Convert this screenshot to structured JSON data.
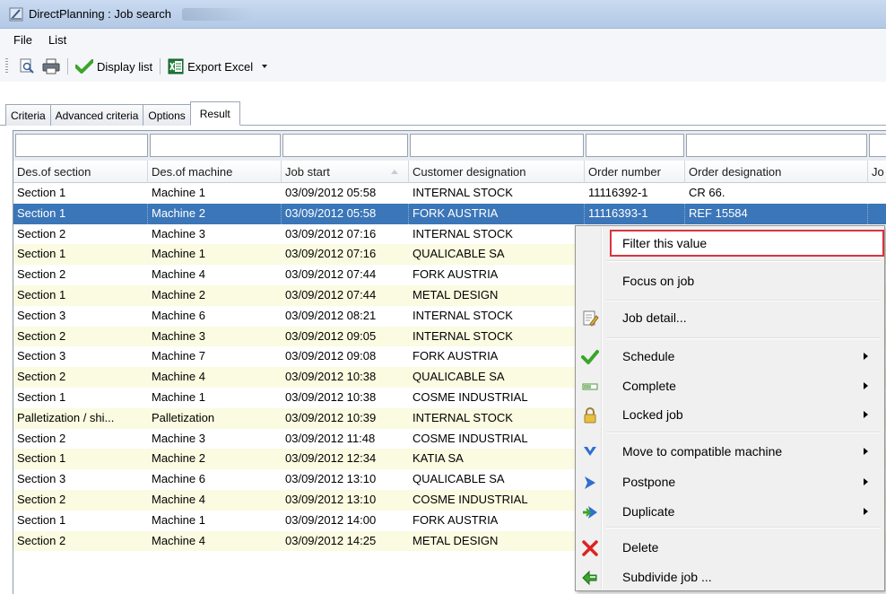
{
  "window": {
    "title": "DirectPlanning : Job search"
  },
  "menubar": {
    "items": [
      "File",
      "List"
    ]
  },
  "toolbar": {
    "preview_icon": "print-preview-icon",
    "print_icon": "printer-icon",
    "display_list_label": "Display list",
    "export_excel_label": "Export Excel"
  },
  "tabs": [
    "Criteria",
    "Advanced criteria",
    "Options",
    "Result"
  ],
  "active_tab": "Result",
  "grid": {
    "columns": [
      "Des.of section",
      "Des.of machine",
      "Job start",
      "Customer designation",
      "Order number",
      "Order designation",
      "Jo"
    ],
    "rows": [
      [
        "Section 1",
        "Machine 1",
        "03/09/2012 05:58",
        "INTERNAL STOCK",
        "11116392-1",
        "CR 66."
      ],
      [
        "Section 1",
        "Machine 2",
        "03/09/2012 05:58",
        "FORK AUSTRIA",
        "11116393-1",
        "REF 15584"
      ],
      [
        "Section 2",
        "Machine 3",
        "03/09/2012 07:16",
        "INTERNAL STOCK",
        "",
        ""
      ],
      [
        "Section 1",
        "Machine 1",
        "03/09/2012 07:16",
        "QUALICABLE SA",
        "",
        ""
      ],
      [
        "Section 2",
        "Machine 4",
        "03/09/2012 07:44",
        "FORK AUSTRIA",
        "",
        ""
      ],
      [
        "Section 1",
        "Machine 2",
        "03/09/2012 07:44",
        "METAL DESIGN",
        "",
        ""
      ],
      [
        "Section 3",
        "Machine 6",
        "03/09/2012 08:21",
        "INTERNAL STOCK",
        "",
        ""
      ],
      [
        "Section 2",
        "Machine 3",
        "03/09/2012 09:05",
        "INTERNAL STOCK",
        "",
        ""
      ],
      [
        "Section 3",
        "Machine 7",
        "03/09/2012 09:08",
        "FORK AUSTRIA",
        "",
        ""
      ],
      [
        "Section 2",
        "Machine 4",
        "03/09/2012 10:38",
        "QUALICABLE SA",
        "",
        ""
      ],
      [
        "Section 1",
        "Machine 1",
        "03/09/2012 10:38",
        "COSME INDUSTRIAL",
        "",
        ""
      ],
      [
        "Palletization / shi...",
        "Palletization",
        "03/09/2012 10:39",
        "INTERNAL STOCK",
        "",
        ""
      ],
      [
        "Section 2",
        "Machine 3",
        "03/09/2012 11:48",
        "COSME INDUSTRIAL",
        "",
        ""
      ],
      [
        "Section 1",
        "Machine 2",
        "03/09/2012 12:34",
        "KATIA SA",
        "",
        ""
      ],
      [
        "Section 3",
        "Machine 6",
        "03/09/2012 13:10",
        "QUALICABLE SA",
        "",
        ""
      ],
      [
        "Section 2",
        "Machine 4",
        "03/09/2012 13:10",
        "COSME INDUSTRIAL",
        "",
        ""
      ],
      [
        "Section 1",
        "Machine 1",
        "03/09/2012 14:00",
        "FORK AUSTRIA",
        "",
        ""
      ],
      [
        "Section 2",
        "Machine 4",
        "03/09/2012 14:25",
        "METAL DESIGN",
        "",
        ""
      ]
    ],
    "selected_row": 1
  },
  "context_menu": {
    "items": [
      {
        "label": "Filter this value",
        "icon": "",
        "submenu": false,
        "highlighted": true
      },
      {
        "label": "Focus on job",
        "icon": "",
        "submenu": false
      },
      {
        "label": "Job detail...",
        "icon": "job-detail-icon",
        "submenu": false
      },
      {
        "label": "Schedule",
        "icon": "checkmark-icon",
        "submenu": true
      },
      {
        "label": "Complete",
        "icon": "progress-bar-icon",
        "submenu": true
      },
      {
        "label": "Locked job",
        "icon": "padlock-icon",
        "submenu": true
      },
      {
        "label": "Move to compatible machine",
        "icon": "down-chevron-icon",
        "submenu": true
      },
      {
        "label": "Postpone",
        "icon": "right-arrow-icon",
        "submenu": true
      },
      {
        "label": "Duplicate",
        "icon": "duplicate-arrow-icon",
        "submenu": true
      },
      {
        "label": "Delete",
        "icon": "delete-x-icon",
        "submenu": false
      },
      {
        "label": "Subdivide job ...",
        "icon": "subdivide-icon",
        "submenu": false
      }
    ]
  },
  "colors": {
    "selection": "#3b76b8",
    "alt_row": "#fafbe0",
    "highlight_border": "#d9343e"
  }
}
